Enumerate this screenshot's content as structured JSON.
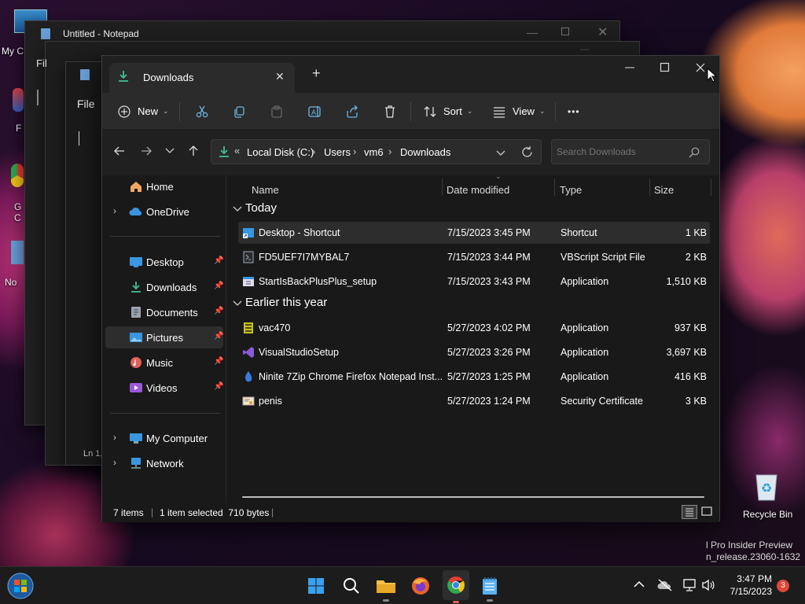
{
  "desktop": {
    "left_labels": [
      "My C",
      "F",
      "G",
      "C",
      "No"
    ],
    "recycle_bin": "Recycle Bin",
    "watermark_line1": "l Pro Insider Preview",
    "watermark_line2": "n_release.23060-1632"
  },
  "notepad": {
    "title": "Untitled - Notepad",
    "menu_file": "File",
    "status_ln": "Ln 1,"
  },
  "notepad2": {
    "menu_file": "Fil"
  },
  "explorer": {
    "tab_title": "Downloads",
    "new_tab": "+",
    "toolbar": {
      "new_label": "New",
      "sort_label": "Sort",
      "view_label": "View",
      "more_label": "•••"
    },
    "address": {
      "prefix": "«",
      "segments": [
        "Local Disk (C:)",
        "Users",
        "vm6",
        "Downloads"
      ],
      "separator": "›"
    },
    "search_placeholder": "Search Downloads",
    "nav": {
      "home": "Home",
      "onedrive": "OneDrive",
      "quick": [
        {
          "label": "Desktop",
          "icon": "desktop-icon"
        },
        {
          "label": "Downloads",
          "icon": "downloads-icon"
        },
        {
          "label": "Documents",
          "icon": "documents-icon"
        },
        {
          "label": "Pictures",
          "icon": "pictures-icon"
        },
        {
          "label": "Music",
          "icon": "music-icon"
        },
        {
          "label": "Videos",
          "icon": "videos-icon"
        }
      ],
      "my_computer": "My Computer",
      "network": "Network"
    },
    "columns": {
      "name": "Name",
      "date": "Date modified",
      "type": "Type",
      "size": "Size"
    },
    "groups": [
      {
        "label": "Today",
        "files": [
          {
            "name": "Desktop - Shortcut",
            "date": "7/15/2023 3:45 PM",
            "type": "Shortcut",
            "size": "1 KB",
            "icon": "shortcut-icon",
            "selected": true
          },
          {
            "name": "FD5UEF7I7MYBAL7",
            "date": "7/15/2023 3:44 PM",
            "type": "VBScript Script File",
            "size": "2 KB",
            "icon": "script-icon"
          },
          {
            "name": "StartIsBackPlusPlus_setup",
            "date": "7/15/2023 3:43 PM",
            "type": "Application",
            "size": "1,510 KB",
            "icon": "installer-icon"
          }
        ]
      },
      {
        "label": "Earlier this year",
        "files": [
          {
            "name": "vac470",
            "date": "5/27/2023 4:02 PM",
            "type": "Application",
            "size": "937 KB",
            "icon": "app-icon"
          },
          {
            "name": "VisualStudioSetup",
            "date": "5/27/2023 3:26 PM",
            "type": "Application",
            "size": "3,697 KB",
            "icon": "visual-studio-icon"
          },
          {
            "name": "Ninite 7Zip Chrome Firefox Notepad Inst...",
            "date": "5/27/2023 1:25 PM",
            "type": "Application",
            "size": "416 KB",
            "icon": "ninite-icon"
          },
          {
            "name": "penis",
            "date": "5/27/2023 1:24 PM",
            "type": "Security Certificate",
            "size": "3 KB",
            "icon": "certificate-icon"
          }
        ]
      }
    ],
    "status": {
      "items": "7 items",
      "selected": "1 item selected  710 bytes"
    }
  },
  "taskbar": {
    "time": "3:47 PM",
    "date": "7/15/2023",
    "notification_count": "3"
  },
  "colors": {
    "accent": "#60cdff",
    "selection": "#2d2d2d",
    "badge": "#e0473a"
  }
}
